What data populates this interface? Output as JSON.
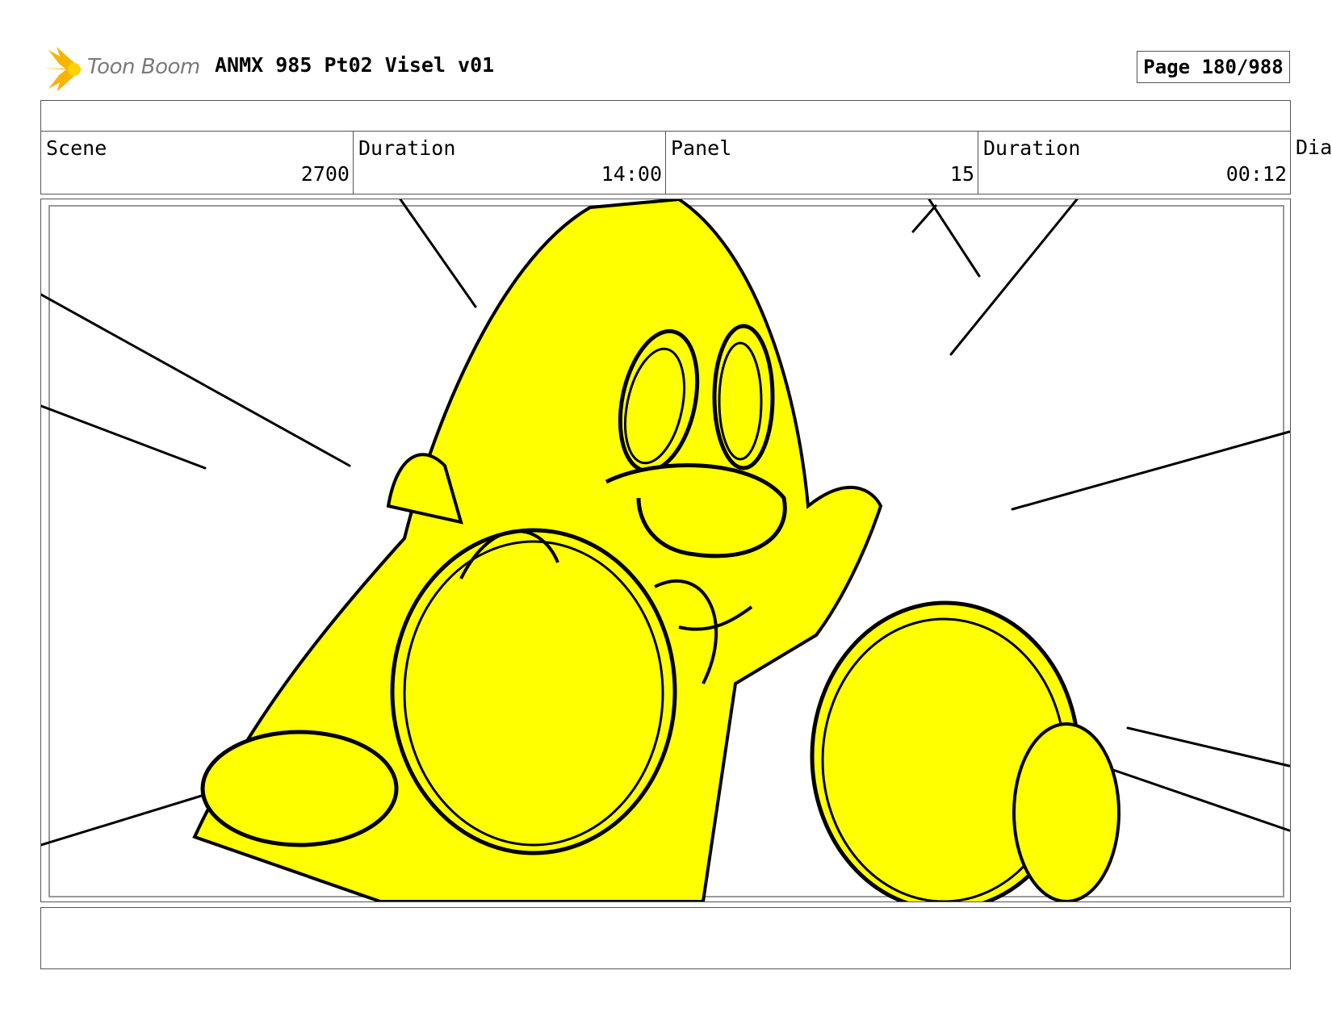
{
  "header": {
    "logo_text": "Toon Boom",
    "title": "ANMX 985 Pt02 Visel v01",
    "page_label": "Page 180/988"
  },
  "info": {
    "scene_label": "Scene",
    "scene_value": "2700",
    "scene_duration_label": "Duration",
    "scene_duration_value": "14:00",
    "panel_label": "Panel",
    "panel_value": "15",
    "panel_duration_label": "Duration",
    "panel_duration_value": "00:12",
    "dialog_label_partial": "Dia"
  },
  "panel": {
    "image_description_icon": "storyboard-sketch",
    "fill_color": "#ffff00",
    "line_color": "#000000"
  },
  "notes": {
    "text": ""
  }
}
